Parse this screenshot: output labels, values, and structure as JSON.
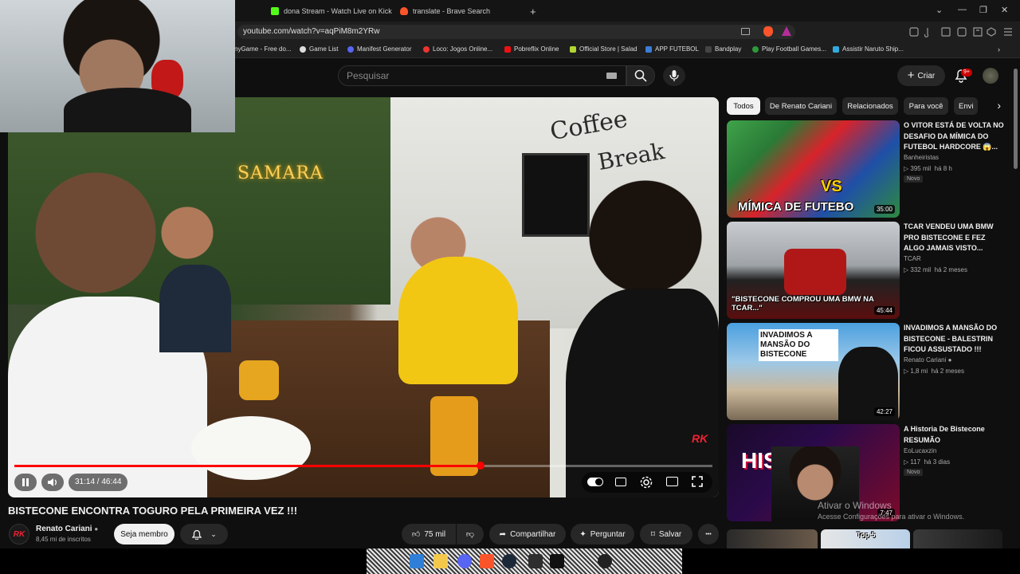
{
  "browser": {
    "tabs": [
      {
        "title": "dona Stream - Watch Live on Kick",
        "color": "#53fc18"
      },
      {
        "title": "translate - Brave Search",
        "color": "#fb542b"
      }
    ],
    "new_tab": "+",
    "url": "youtube.com/watch?v=aqPiM8m2YRw",
    "bookmarks": [
      {
        "label": "nyGame - Free do...",
        "color": "#888"
      },
      {
        "label": "Game List",
        "color": "#ddd"
      },
      {
        "label": "Manifest Generator",
        "color": "#5865f2"
      },
      {
        "label": "Loco: Jogos Online...",
        "color": "#e33"
      },
      {
        "label": "Pobreflix Online",
        "color": "#e11"
      },
      {
        "label": "Official Store | Salad",
        "color": "#b2d530"
      },
      {
        "label": "APP FUTEBOL",
        "color": "#3b7dd8"
      },
      {
        "label": "Bandplay",
        "color": "#222"
      },
      {
        "label": "Play Football Games...",
        "color": "#2d9a3a"
      },
      {
        "label": "Assistir Naruto Ship...",
        "color": "#3ad"
      }
    ],
    "window_controls": [
      "⌄",
      "—",
      "❐",
      "✕"
    ]
  },
  "header": {
    "search_placeholder": "Pesquisar",
    "create_label": "Criar",
    "notif_count": "9+"
  },
  "player": {
    "sign_samara": "SAMARA",
    "sign_coffee": "Coffee",
    "sign_break": "Break",
    "watermark_logo": "RK",
    "current_time": "31:14",
    "duration": "46:44",
    "time_display": "31:14 / 46:44",
    "progress": 0.668,
    "accent": "#ff0000"
  },
  "video": {
    "title": "BISTECONE ENCONTRA TOGURO PELA PRIMEIRA VEZ !!!",
    "channel": "Renato Cariani",
    "channel_avatar": "RK",
    "subscribers": "8,45 mi de inscritos",
    "member_button": "Seja membro",
    "likes": "75 mil",
    "share": "Compartilhar",
    "ask": "Perguntar",
    "save": "Salvar",
    "more": "•••"
  },
  "chips": [
    "Todos",
    "De Renato Cariani",
    "Relacionados",
    "Para você",
    "Envi"
  ],
  "recommendations": [
    {
      "title": "O VITOR ESTÁ DE VOLTA NO DESAFIO DA MÍMICA DO FUTEBOL HARDCORE 😱...",
      "channel": "Banheiristas",
      "views": "395 mil",
      "age": "há 8 h",
      "duration": "35:00",
      "badge": "Novo",
      "thumb_text": "MÍMICA DE FUTEBO",
      "verified": false
    },
    {
      "title": "TCAR VENDEU UMA BMW PRO BISTECONE E FEZ ALGO JAMAIS VISTO...",
      "channel": "TCAR",
      "views": "332 mil",
      "age": "há 2 meses",
      "duration": "45:44",
      "thumb_text": "\"BISTECONE COMPROU UMA BMW NA TCAR...\"",
      "verified": false
    },
    {
      "title": "INVADIMOS A MANSÃO DO BISTECONE - BALESTRIN FICOU ASSUSTADO !!!",
      "channel": "Renato Cariani",
      "views": "1,8 mi",
      "age": "há 2 meses",
      "duration": "42:27",
      "thumb_text": "INVADIMOS A MANSÃO DO BISTECONE",
      "verified": true
    },
    {
      "title": "A Historia De Bistecone RESUMÃO",
      "channel": "EoLucaxzin",
      "views": "117",
      "age": "há 3 dias",
      "duration": "7:47",
      "badge": "Novo",
      "thumb_text": "HISTORIA",
      "verified": false
    }
  ],
  "bottom_thumb_text": "Top 5",
  "windows_watermark": {
    "line1": "Ativar o Windows",
    "line2": "Acesse Configurações para ativar o Windows."
  }
}
